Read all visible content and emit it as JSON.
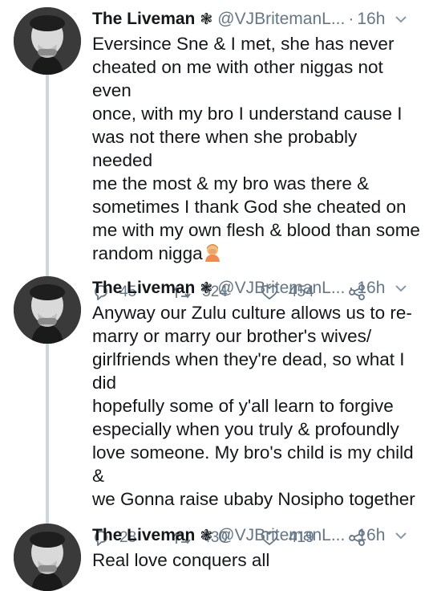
{
  "tweets": [
    {
      "name": "The Liveman",
      "badge": "❃",
      "handle": "@VJBritemanL...",
      "separator": "·",
      "time": "16h",
      "text": "Eversince Sne & I met, she has never\ncheated on me with other niggas not even\nonce, with my bro I understand cause I\nwas not there when she probably needed\nme the most & my bro was there &\nsometimes I thank God she cheated on\nme with my own flesh & blood than some\nrandom nigga",
      "emoji": "person-facepalming",
      "replies": "45",
      "retweets": "524",
      "likes": "454"
    },
    {
      "name": "The Liveman",
      "badge": "❃",
      "handle": "@VJBritemanL...",
      "separator": "·",
      "time": "16h",
      "text": "Anyway our Zulu culture allows us to re-\nmarry or marry our brother's wives/\ngirlfriends when they're dead, so what I did\nhopefully some of y'all learn to forgive\nespecially when you truly & profoundly\nlove someone. My bro's child is my child &\nwe Gonna raise ubaby Nosipho together",
      "replies": "28",
      "retweets": "430",
      "likes": "419"
    },
    {
      "name": "The Liveman",
      "badge": "❃",
      "handle": "@VJBritemanL...",
      "separator": "·",
      "time": "16h",
      "text": "Real love conquers all"
    }
  ],
  "colors": {
    "text": "#14171a",
    "secondary": "#657786",
    "thread_line": "#ccd6dd"
  }
}
